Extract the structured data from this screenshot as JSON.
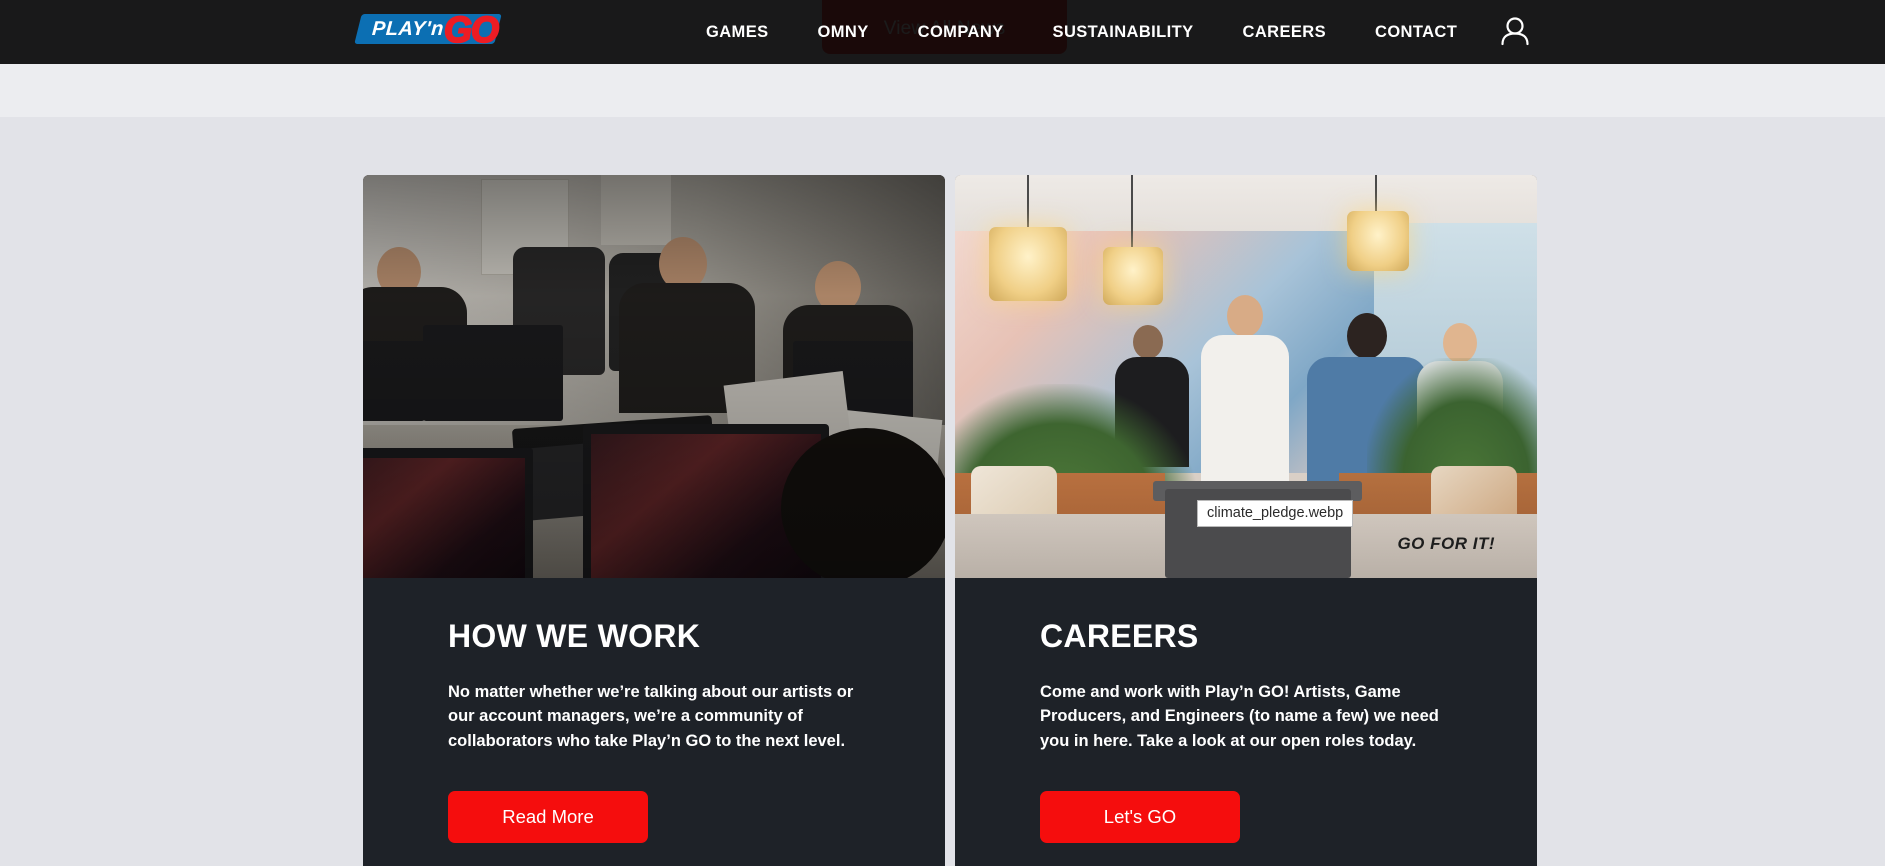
{
  "header": {
    "logo": {
      "name": "playn-go-logo",
      "primary_text": "PLAY'n",
      "accent_text": "GO",
      "slab_color": "#0c6fb3",
      "accent_color": "#ec1c24"
    },
    "nav": [
      {
        "label": "GAMES",
        "name": "nav-games"
      },
      {
        "label": "OMNY",
        "name": "nav-omny"
      },
      {
        "label": "COMPANY",
        "name": "nav-company"
      },
      {
        "label": "SUSTAINABILITY",
        "name": "nav-sustainability"
      },
      {
        "label": "CAREERS",
        "name": "nav-careers"
      },
      {
        "label": "CONTACT",
        "name": "nav-contact"
      }
    ],
    "account_icon": "user-account-icon",
    "background_color": "#0a0a0a"
  },
  "scrolled_cta": {
    "label": "View All News",
    "color": "#e60b0b"
  },
  "cards": [
    {
      "title": "HOW WE WORK",
      "text": "No matter whether we’re talking about our artists or our account managers, we’re a community of collaborators who take Play’n GO to the next level.",
      "button_label": "Read More",
      "image_alt": "office-workstations-photo"
    },
    {
      "title": "CAREERS",
      "text": "Come and work with Play’n GO! Artists, Game Producers, and Engineers (to name a few) we need you in here. Take a look at our open roles today.",
      "button_label": "Let's GO",
      "image_alt": "office-lounge-photo",
      "image_overlay_text": "GO FOR IT!"
    }
  ],
  "tooltip": {
    "text": "climate_pledge.webp"
  },
  "theme": {
    "card_background": "#1e2228",
    "button_red": "#f50d0d",
    "page_background": "#e2e3e8",
    "band_background": "#ecedf0"
  }
}
